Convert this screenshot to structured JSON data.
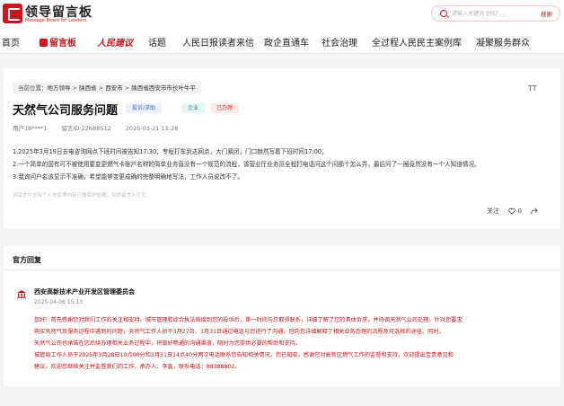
{
  "header": {
    "logo_title": "领导留言板",
    "logo_subtitle": "Message Board for Leaders",
    "search_placeholder": "请输入关键词 例如“...",
    "search_button": "搜索"
  },
  "nav": {
    "items": [
      {
        "label": "首页"
      },
      {
        "label": "留言板"
      },
      {
        "label": "人民建议"
      },
      {
        "label": "话题"
      },
      {
        "label": "人民日报读者来信"
      },
      {
        "label": "政企直通车"
      },
      {
        "label": "社会治理"
      },
      {
        "label": "全过程人民民主案例库"
      },
      {
        "label": "凝聚服务群众"
      }
    ]
  },
  "breadcrumb": {
    "prefix": "当前位置：",
    "items": [
      "地方领导",
      "陕西省",
      "西安市",
      "陕西省西安市市长叶牛平"
    ]
  },
  "font_button": "TT",
  "message": {
    "title": "天然气公司服务问题",
    "tags": {
      "type": "投诉/求助",
      "org": "企业",
      "status": "已办理"
    },
    "user": "用户18****1",
    "message_id": "留言ID:22688512",
    "date": "2025-03-21 11:28",
    "paragraphs": [
      "1.2025年3月19日去电咨询网点下班时间被告知17:30，专程打车到达网点，大门紧闭，门口赫然写着下班时间17:00。",
      "2.一个简单的国有可不被使用要变更燃气卡账户名称的简单业务竟没有一个规范的流程，该营业厅业务员全程打电话问这个问那个怎么弄，最后问了一圈竟然没有一个人知道情况。",
      "3.我询问户名该显示不准确，希望能够变更成确的完整明确地写法，工作人员说改不了。"
    ],
    "disclaimer": "该留言中含有个人信息等内容已做保护处理，仅供留言人可见。",
    "actions": {
      "follow": "关注",
      "likes": "0"
    }
  },
  "reply": {
    "heading": "官方回复",
    "org_name": "西安高新技术产业开发区管理委员会",
    "date": "2025-04-06 15:13",
    "paragraphs": [
      "您好！首先感谢您对我们工作的关注和支持。城市管理和综合执法局接到您的投诉后，第一时间与您取得联系，详细了解了您的具体诉求，并协调天然气公司处理。针对您要求",
      "购买天然气及服务过程中遇到的问题，天然气工作人员于3月27日、3月31日通过电话与您进行了沟通，已向您详细解释了相关业务办理的流程及可选择的途径。同时，",
      "天然气公司也承诺在您后续办理相关业务过程中，将做好畅通的沟通渠道，随时为您提供必要的帮助和支持。",
      "城管局工作人员于2025年3月28日10点00分和3月31日14点40分两次电话联系您告知相关情况，您已知晓。感谢您对高新区燃气工作的监督和支持，欢迎提出宝贵意见和",
      "建议。欢迎您继续关注并监督我们的工作。承办人：李鑫，联系电话：88388802。"
    ]
  },
  "colors": {
    "brand": "#c7161e",
    "background": "#f3f4f6"
  }
}
